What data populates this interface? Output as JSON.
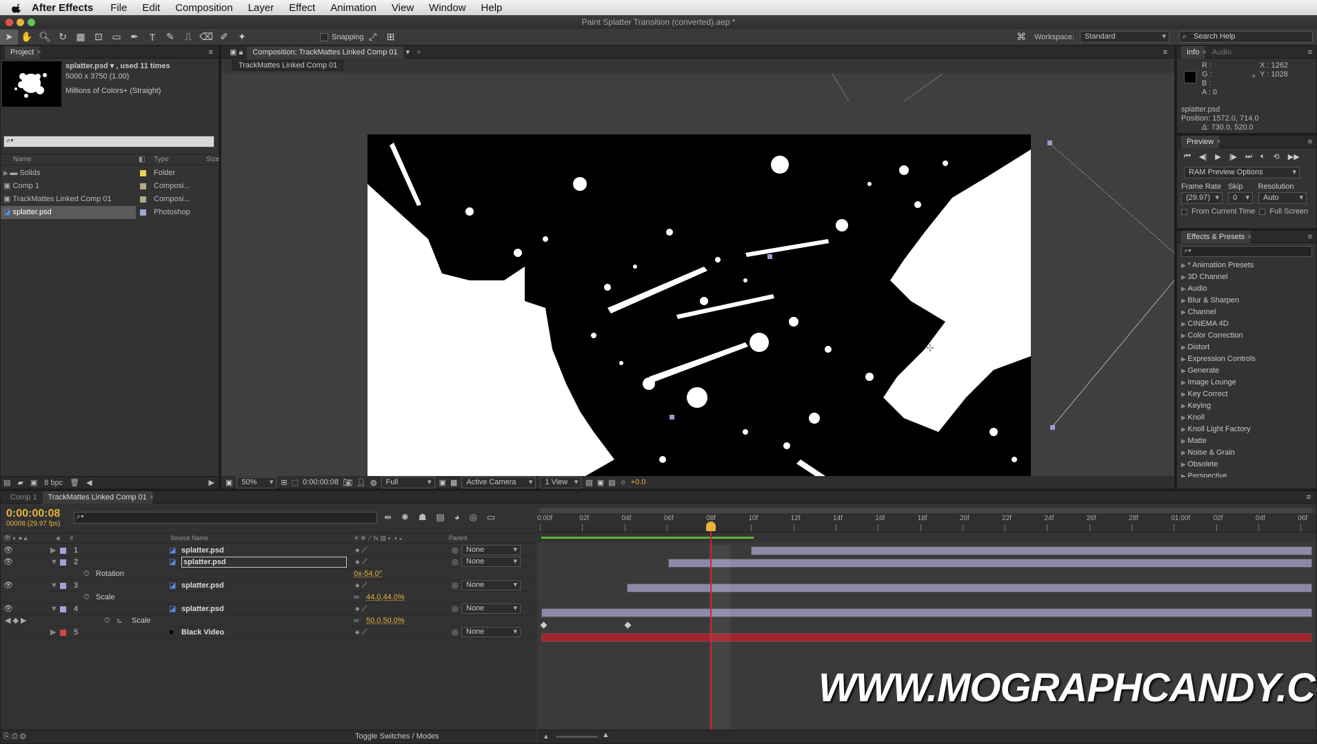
{
  "menubar": {
    "app_name": "After Effects",
    "items": [
      "File",
      "Edit",
      "Composition",
      "Layer",
      "Effect",
      "Animation",
      "View",
      "Window",
      "Help"
    ]
  },
  "window_title": "Paint Splatter Transition (converted).aep *",
  "toolbar": {
    "snapping_label": "Snapping",
    "workspace_label": "Workspace:",
    "workspace_value": "Standard",
    "search_placeholder": "Search Help"
  },
  "project": {
    "tab": "Project",
    "selected_name": "splatter.psd ▾ , used 11 times",
    "selected_dims": "5000 x 3750 (1.00)",
    "selected_color": "Millions of Colors+ (Straight)",
    "col_name": "Name",
    "col_type": "Type",
    "col_size": "Size",
    "items": [
      {
        "name": "Solids",
        "type": "Folder",
        "color": "#e6d44a",
        "icon": "folder-icon"
      },
      {
        "name": "Comp 1",
        "type": "Composi...",
        "color": "#b4a986",
        "icon": "composition-icon"
      },
      {
        "name": "TrackMattes Linked Comp 01",
        "type": "Composi...",
        "color": "#b4a986",
        "icon": "composition-icon"
      },
      {
        "name": "splatter.psd",
        "type": "Photoshop",
        "color": "#9ea4d8",
        "icon": "photoshop-file-icon"
      }
    ],
    "bpc": "8 bpc"
  },
  "composition": {
    "tab": "Composition: TrackMattes Linked Comp 01",
    "breadcrumb": "TrackMattes Linked Comp 01",
    "zoom": "50%",
    "timecode": "0:00:00:08",
    "resolution": "Full",
    "camera": "Active Camera",
    "view": "1 View",
    "exposure": "+0.0"
  },
  "info": {
    "tab_info": "Info",
    "tab_audio": "Audio",
    "r": "R :",
    "g": "G :",
    "b": "B :",
    "a": "A : 0",
    "x": "X : 1262",
    "y": "Y : 1028",
    "layer": "splatter.psd",
    "position": "Position: 1572.0, 714.0",
    "delta": "Δ: 730.0, 520.0"
  },
  "preview": {
    "tab": "Preview",
    "options": "RAM Preview Options",
    "frame_rate_label": "Frame Rate",
    "skip_label": "Skip",
    "resolution_label": "Resolution",
    "frame_rate": "(29.97)",
    "skip": "0",
    "resolution": "Auto",
    "from_current": "From Current Time",
    "full_screen": "Full Screen"
  },
  "effects": {
    "tab": "Effects & Presets",
    "items": [
      "* Animation Presets",
      "3D Channel",
      "Audio",
      "Blur & Sharpen",
      "Channel",
      "CINEMA 4D",
      "Color Correction",
      "Distort",
      "Expression Controls",
      "Generate",
      "Image Lounge",
      "Key Correct",
      "Keying",
      "Knoll",
      "Knoll Light Factory",
      "Matte",
      "Noise & Grain",
      "Obsolete",
      "Perspective"
    ]
  },
  "timeline": {
    "tab1": "Comp 1",
    "tab2": "TrackMattes Linked Comp 01",
    "timecode": "0:00:00:08",
    "frame_info": "00008 (29.97 fps)",
    "col_source": "Source Name",
    "col_parent": "Parent",
    "col_num": "#",
    "ruler": [
      "0:00f",
      "02f",
      "04f",
      "06f",
      "08f",
      "10f",
      "12f",
      "14f",
      "16f",
      "18f",
      "20f",
      "22f",
      "24f",
      "26f",
      "28f",
      "01:00f",
      "02f",
      "04f",
      "06f"
    ],
    "layers": [
      {
        "num": "1",
        "name": "splatter.psd",
        "parent": "None",
        "color": "#9ea4d8"
      },
      {
        "num": "2",
        "name": "splatter.psd",
        "parent": "None",
        "color": "#9ea4d8"
      },
      {
        "num": "3",
        "name": "splatter.psd",
        "parent": "None",
        "color": "#9ea4d8"
      },
      {
        "num": "4",
        "name": "splatter.psd",
        "parent": "None",
        "color": "#9ea4d8"
      },
      {
        "num": "5",
        "name": "Black Video",
        "parent": "None",
        "color": "#d64545"
      }
    ],
    "props": {
      "rotation_label": "Rotation",
      "rotation_value": "0x-54.0°",
      "scale3_label": "Scale",
      "scale3_value": "44.0,44.0%",
      "scale4_label": "Scale",
      "scale4_value": "50.0,50.0%"
    },
    "toggle_label": "Toggle Switches / Modes"
  },
  "watermark": "WWW.MOGRAPHCANDY.COM",
  "colors": {
    "accent_yellow": "#e8b33c",
    "layer_bar": "#8d8aa8",
    "black_video_bar": "#a3242f",
    "playhead": "#d0203a"
  }
}
